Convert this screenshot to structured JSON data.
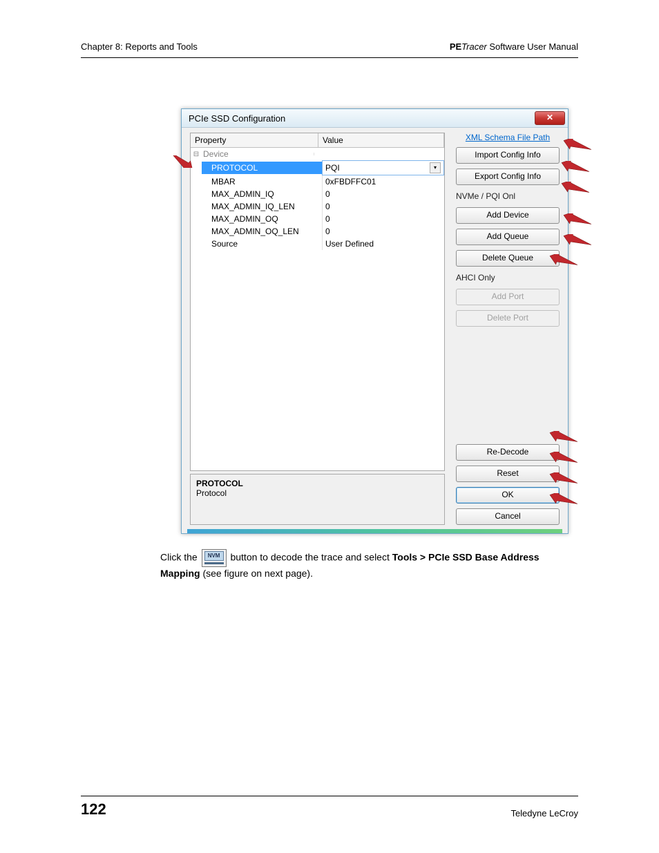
{
  "header": {
    "left": "Chapter 8: Reports and Tools",
    "right_prefix": "PE",
    "right_italic": "Tracer",
    "right_suffix": " Software User Manual"
  },
  "dialog": {
    "title": "PCIe SSD Configuration",
    "grid_header": {
      "property": "Property",
      "value": "Value"
    },
    "category": "Device",
    "rows": [
      {
        "prop": "PROTOCOL",
        "val": "PQI",
        "selected": true,
        "dropdown": true
      },
      {
        "prop": "MBAR",
        "val": "0xFBDFFC01"
      },
      {
        "prop": "MAX_ADMIN_IQ",
        "val": "0"
      },
      {
        "prop": "MAX_ADMIN_IQ_LEN",
        "val": "0"
      },
      {
        "prop": "MAX_ADMIN_OQ",
        "val": "0"
      },
      {
        "prop": "MAX_ADMIN_OQ_LEN",
        "val": "0"
      },
      {
        "prop": "Source",
        "val": "User Defined"
      }
    ],
    "desc": {
      "name": "PROTOCOL",
      "text": "Protocol"
    },
    "right": {
      "schema_link": "XML Schema File Path",
      "import_btn": "Import Config Info",
      "export_btn": "Export Config Info",
      "nvme_label": "NVMe / PQI Onl",
      "add_device": "Add Device",
      "add_queue": "Add Queue",
      "delete_queue": "Delete Queue",
      "ahci_label": "AHCI Only",
      "add_port": "Add Port",
      "delete_port": "Delete Port",
      "re_decode": "Re-Decode",
      "reset": "Reset",
      "ok": "OK",
      "cancel": "Cancel"
    }
  },
  "body_text": {
    "line1a": "Click the ",
    "nvm": "NVM",
    "line1b": " button to decode the trace and select ",
    "bold_menu": "Tools > PCIe SSD Base Address Mapping",
    "line2": " (see figure on next page)."
  },
  "footer": {
    "page_num": "122",
    "right": "Teledyne LeCroy"
  }
}
